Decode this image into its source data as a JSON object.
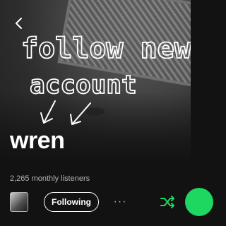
{
  "header": {
    "back_icon": "chevron-left-icon",
    "scribble_line1": "follow new",
    "scribble_line2": "account"
  },
  "artist": {
    "name": "wren",
    "monthly_listeners": "2,265 monthly listeners"
  },
  "actions": {
    "follow_label": "Following",
    "more_label": "···",
    "shuffle_icon": "shuffle-icon",
    "play_icon": "play-icon",
    "accent_color": "#1ed760"
  }
}
